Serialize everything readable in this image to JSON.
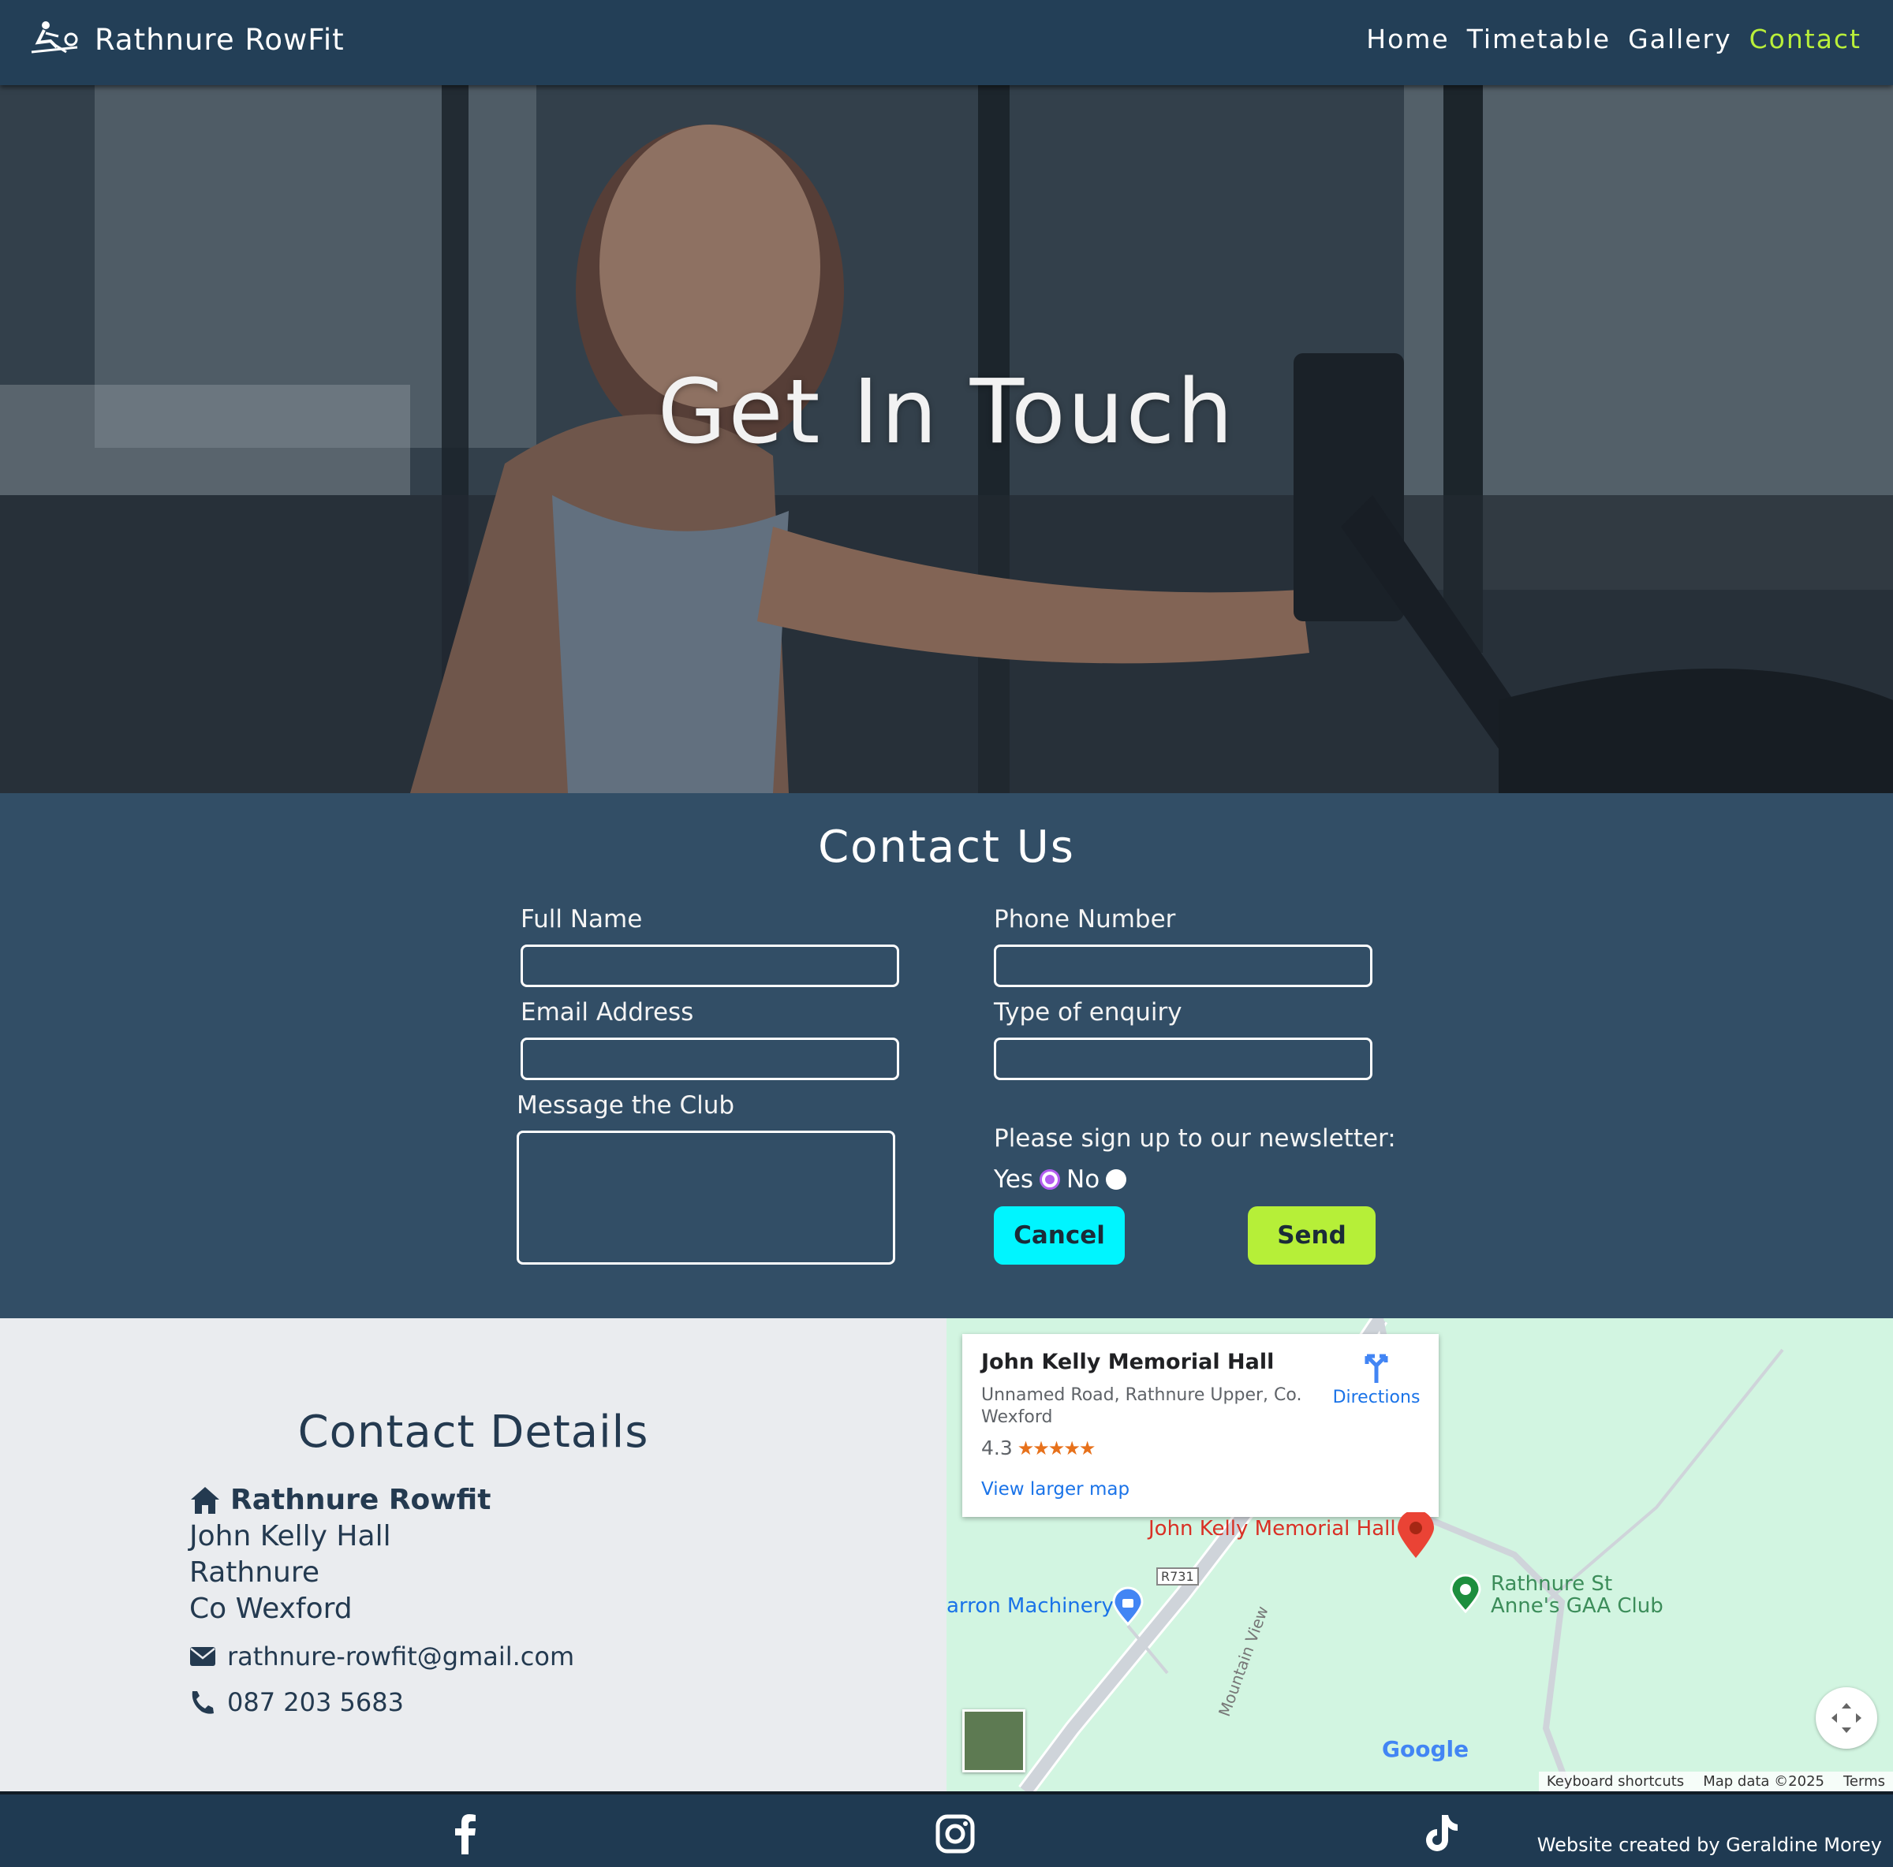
{
  "nav": {
    "brand": "Rathnure RowFit",
    "links": [
      "Home",
      "Timetable",
      "Gallery",
      "Contact"
    ],
    "active": "Contact"
  },
  "hero": {
    "title": "Get In Touch"
  },
  "form": {
    "title": "Contact Us",
    "full_name_label": "Full Name",
    "phone_label": "Phone Number",
    "email_label": "Email Address",
    "enquiry_label": "Type of enquiry",
    "message_label": "Message the Club",
    "newsletter_label": "Please sign up to our newsletter:",
    "yes_label": "Yes",
    "no_label": "No",
    "newsletter_selected": "Yes",
    "cancel_label": "Cancel",
    "send_label": "Send",
    "full_name_value": "",
    "phone_value": "",
    "email_value": "",
    "enquiry_value": "",
    "message_value": ""
  },
  "details": {
    "title": "Contact Details",
    "name": "Rathnure Rowfit",
    "address_lines": [
      "John Kelly Hall",
      "Rathnure",
      "Co Wexford"
    ],
    "email": "rathnure-rowfit@gmail.com",
    "phone": "087 203 5683"
  },
  "map": {
    "place_name": "John Kelly Memorial Hall",
    "address": "Unnamed Road, Rathnure Upper, Co. Wexford",
    "rating": "4.3",
    "stars": "★★★★★",
    "directions_label": "Directions",
    "larger_map_label": "View larger map",
    "pin_label": "John Kelly Memorial Hall",
    "poi_machinery": "arron Machinery",
    "poi_gaa_line1": "Rathnure St",
    "poi_gaa_line2": "Anne's GAA Club",
    "road_label": "R731",
    "street_label": "Mountain View",
    "google_logo": "Google",
    "footer_links": [
      "Keyboard shortcuts",
      "Map data ©2025",
      "Terms"
    ]
  },
  "footer": {
    "social": [
      "facebook-icon",
      "instagram-icon",
      "tiktok-icon"
    ],
    "credit": "Website created by Geraldine Morey"
  },
  "colors": {
    "nav_bg": "#233f57",
    "contact_bg": "#324e66",
    "accent_active": "#b9ef3a",
    "cancel_btn": "#00f5ff",
    "send_btn": "#b6ef38",
    "details_text": "#243a50"
  }
}
